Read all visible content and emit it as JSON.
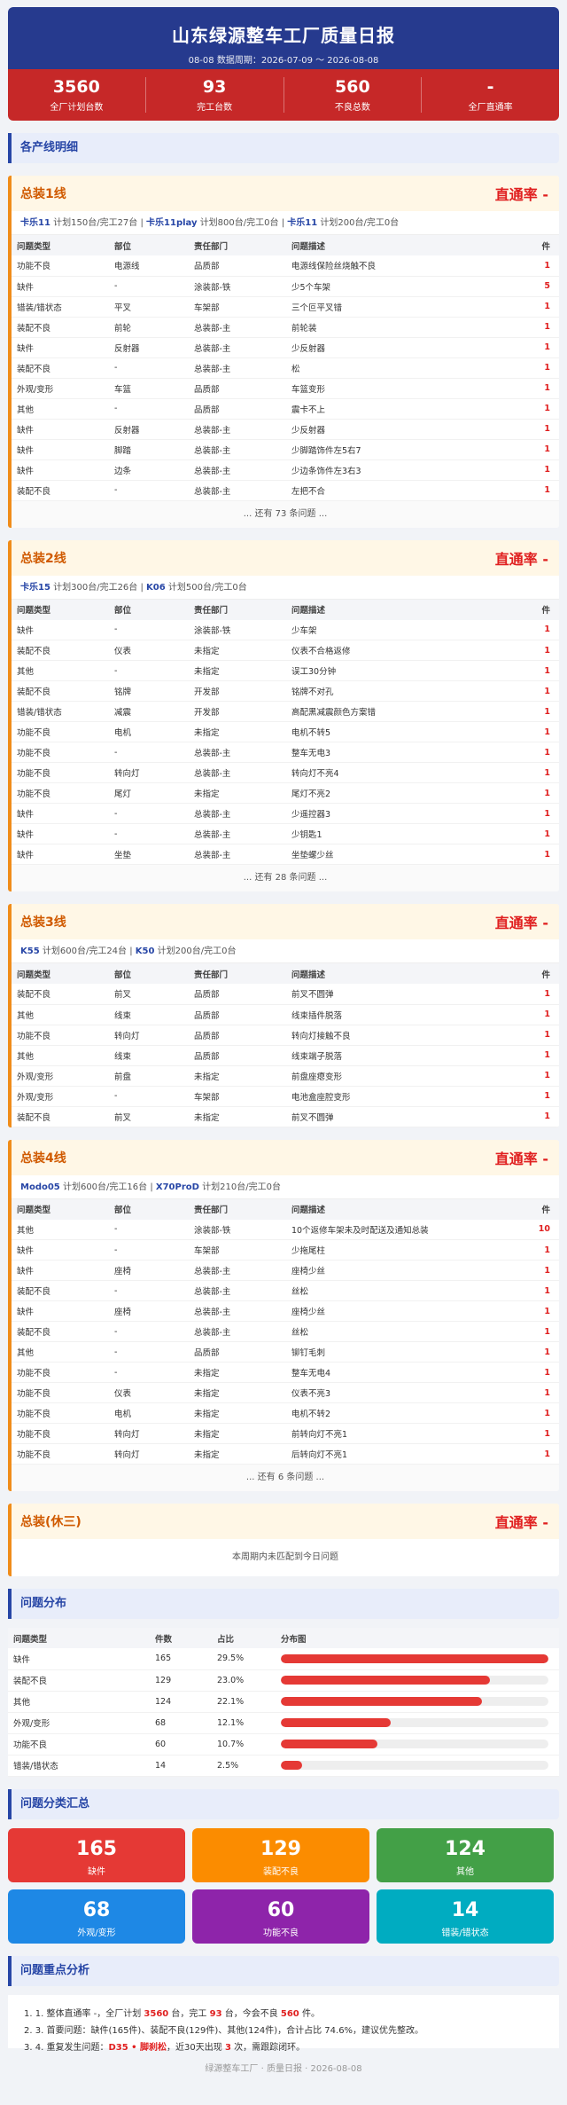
{
  "header": {
    "title": "山东绿源整车工厂质量日报",
    "subtitle": "08-08 数据周期：2026-07-09 ～ 2026-08-08"
  },
  "kpis": [
    {
      "value": "3560",
      "label": "全厂计划台数"
    },
    {
      "value": "93",
      "label": "完工台数"
    },
    {
      "value": "560",
      "label": "不良总数"
    },
    {
      "value": "-",
      "label": "全厂直通率"
    }
  ],
  "section_lines": "各产线明细",
  "table_head": [
    "问题类型",
    "部位",
    "责任部门",
    "问题描述",
    "件"
  ],
  "lines": [
    {
      "name": "总装1线",
      "rate": "直通率 -",
      "plans": [
        {
          "model": "卡乐11",
          "text": "计划150台/完工27台"
        },
        {
          "model": "卡乐11play",
          "text": "计划800台/完工0台"
        },
        {
          "model": "卡乐11",
          "text": "计划200台/完工0台"
        }
      ],
      "rows": [
        [
          "功能不良",
          "电源线",
          "品质部",
          "电源线保险丝烧触不良",
          "1"
        ],
        [
          "缺件",
          "-",
          "涂装部-铁",
          "少5个车架",
          "5"
        ],
        [
          "错装/错状态",
          "平叉",
          "车架部",
          "三个叵平叉错",
          "1"
        ],
        [
          "装配不良",
          "前轮",
          "总装部-主",
          "前轮装",
          "1"
        ],
        [
          "缺件",
          "反射器",
          "总装部-主",
          "少反射器",
          "1"
        ],
        [
          "装配不良",
          "-",
          "总装部-主",
          "松",
          "1"
        ],
        [
          "外观/变形",
          "车篮",
          "品质部",
          "车篮变形",
          "1"
        ],
        [
          "其他",
          "-",
          "品质部",
          "震卡不上",
          "1"
        ],
        [
          "缺件",
          "反射器",
          "总装部-主",
          "少反射器",
          "1"
        ],
        [
          "缺件",
          "脚踏",
          "总装部-主",
          "少脚踏饰件左5右7",
          "1"
        ],
        [
          "缺件",
          "边条",
          "总装部-主",
          "少边条饰件左3右3",
          "1"
        ],
        [
          "装配不良",
          "-",
          "总装部-主",
          "左把不合",
          "1"
        ]
      ],
      "more": "... 还有 73 条问题 ..."
    },
    {
      "name": "总装2线",
      "rate": "直通率 -",
      "plans": [
        {
          "model": "卡乐15",
          "text": "计划300台/完工26台"
        },
        {
          "model": "K06",
          "text": "计划500台/完工0台"
        }
      ],
      "rows": [
        [
          "缺件",
          "-",
          "涂装部-铁",
          "少车架",
          "1"
        ],
        [
          "装配不良",
          "仪表",
          "未指定",
          "仪表不合格返修",
          "1"
        ],
        [
          "其他",
          "-",
          "未指定",
          "误工30分钟",
          "1"
        ],
        [
          "装配不良",
          "铭牌",
          "开发部",
          "铭牌不对孔",
          "1"
        ],
        [
          "错装/错状态",
          "减震",
          "开发部",
          "高配黑减震颜色方案错",
          "1"
        ],
        [
          "功能不良",
          "电机",
          "未指定",
          "电机不转5",
          "1"
        ],
        [
          "功能不良",
          "-",
          "总装部-主",
          "整车无电3",
          "1"
        ],
        [
          "功能不良",
          "转向灯",
          "总装部-主",
          "转向灯不亮4",
          "1"
        ],
        [
          "功能不良",
          "尾灯",
          "未指定",
          "尾灯不亮2",
          "1"
        ],
        [
          "缺件",
          "-",
          "总装部-主",
          "少遥控器3",
          "1"
        ],
        [
          "缺件",
          "-",
          "总装部-主",
          "少钥匙1",
          "1"
        ],
        [
          "缺件",
          "坐垫",
          "总装部-主",
          "坐垫螺少丝",
          "1"
        ]
      ],
      "more": "... 还有 28 条问题 ..."
    },
    {
      "name": "总装3线",
      "rate": "直通率 -",
      "plans": [
        {
          "model": "K55",
          "text": "计划600台/完工24台"
        },
        {
          "model": "K50",
          "text": "计划200台/完工0台"
        }
      ],
      "rows": [
        [
          "装配不良",
          "前叉",
          "品质部",
          "前叉不圆弹",
          "1"
        ],
        [
          "其他",
          "线束",
          "品质部",
          "线束插件脱落",
          "1"
        ],
        [
          "功能不良",
          "转向灯",
          "品质部",
          "转向灯接触不良",
          "1"
        ],
        [
          "其他",
          "线束",
          "品质部",
          "线束端子脱落",
          "1"
        ],
        [
          "外观/变形",
          "前盘",
          "未指定",
          "前盘座瘪变形",
          "1"
        ],
        [
          "外观/变形",
          "-",
          "车架部",
          "电池盒座腔变形",
          "1"
        ],
        [
          "装配不良",
          "前叉",
          "未指定",
          "前叉不圆弹",
          "1"
        ]
      ]
    },
    {
      "name": "总装4线",
      "rate": "直通率 -",
      "plans": [
        {
          "model": "Modo05",
          "text": "计划600台/完工16台"
        },
        {
          "model": "X70ProD",
          "text": "计划210台/完工0台"
        }
      ],
      "rows": [
        [
          "其他",
          "-",
          "涂装部-铁",
          "10个返修车架未及时配送及通知总装",
          "10"
        ],
        [
          "缺件",
          "-",
          "车架部",
          "少拖尾柱",
          "1"
        ],
        [
          "缺件",
          "座椅",
          "总装部-主",
          "座椅少丝",
          "1"
        ],
        [
          "装配不良",
          "-",
          "总装部-主",
          "丝松",
          "1"
        ],
        [
          "缺件",
          "座椅",
          "总装部-主",
          "座椅少丝",
          "1"
        ],
        [
          "装配不良",
          "-",
          "总装部-主",
          "丝松",
          "1"
        ],
        [
          "其他",
          "-",
          "品质部",
          "铆钉毛刺",
          "1"
        ],
        [
          "功能不良",
          "-",
          "未指定",
          "整车无电4",
          "1"
        ],
        [
          "功能不良",
          "仪表",
          "未指定",
          "仪表不亮3",
          "1"
        ],
        [
          "功能不良",
          "电机",
          "未指定",
          "电机不转2",
          "1"
        ],
        [
          "功能不良",
          "转向灯",
          "未指定",
          "前转向灯不亮1",
          "1"
        ],
        [
          "功能不良",
          "转向灯",
          "未指定",
          "后转向灯不亮1",
          "1"
        ]
      ],
      "more": "... 还有 6 条问题 ..."
    },
    {
      "name": "总装(休三)",
      "rate": "直通率 -",
      "plans": [],
      "rows": [],
      "empty": "本周期内未匹配到今日问题"
    }
  ],
  "section_dist": "问题分布",
  "dist_head": [
    "问题类型",
    "件数",
    "占比",
    "分布图"
  ],
  "dist": [
    {
      "type": "缺件",
      "count": "165",
      "pct": "29.5%",
      "frac": 1.0
    },
    {
      "type": "装配不良",
      "count": "129",
      "pct": "23.0%",
      "frac": 0.78
    },
    {
      "type": "其他",
      "count": "124",
      "pct": "22.1%",
      "frac": 0.75
    },
    {
      "type": "外观/变形",
      "count": "68",
      "pct": "12.1%",
      "frac": 0.41
    },
    {
      "type": "功能不良",
      "count": "60",
      "pct": "10.7%",
      "frac": 0.36
    },
    {
      "type": "错装/错状态",
      "count": "14",
      "pct": "2.5%",
      "frac": 0.08
    }
  ],
  "section_cards": "问题分类汇总",
  "cards": [
    {
      "value": "165",
      "label": "缺件",
      "color": "#e53935"
    },
    {
      "value": "129",
      "label": "装配不良",
      "color": "#fb8c00"
    },
    {
      "value": "124",
      "label": "其他",
      "color": "#43a047"
    },
    {
      "value": "68",
      "label": "外观/变形",
      "color": "#1e88e5"
    },
    {
      "value": "60",
      "label": "功能不良",
      "color": "#8e24aa"
    },
    {
      "value": "14",
      "label": "错装/错状态",
      "color": "#00acc1"
    }
  ],
  "section_analysis": "问题重点分析",
  "analysis": {
    "l1a": "1. 1. 整体直通率 -，全厂计划 ",
    "l1b": "3560",
    "l1c": " 台，完工 ",
    "l1d": "93",
    "l1e": " 台，今会不良 ",
    "l1f": "560",
    "l1g": " 件。",
    "l2": "2. 3. 首要问题：缺件(165件)、装配不良(129件)、其他(124件)，合计占比 74.6%，建议优先整改。",
    "l3a": "3. 4. 重复发生问题：",
    "l3b": "D35 • 脚刹松",
    "l3c": "，近30天出现 ",
    "l3d": "3",
    "l3e": " 次，需跟踪闭环。"
  },
  "footer": "绿源整车工厂 · 质量日报 · 2026-08-08"
}
